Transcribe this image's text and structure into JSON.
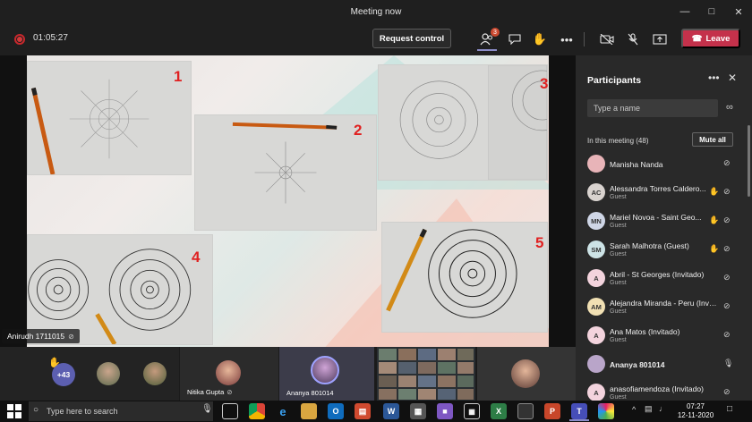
{
  "window": {
    "title": "Meeting now"
  },
  "toolbar": {
    "timer": "01:05:27",
    "request_control_label": "Request control",
    "participants_badge": "3",
    "leave_label": "Leave"
  },
  "share": {
    "photo_numbers": [
      "1",
      "2",
      "3",
      "4",
      "5"
    ],
    "speaker_name": "Anirudh 1711015"
  },
  "participants": {
    "title": "Participants",
    "search_placeholder": "Type a name",
    "in_meeting_label": "In this meeting (48)",
    "mute_all_label": "Mute all",
    "list": [
      {
        "initials": "",
        "name": "Manisha Nanda",
        "role": "",
        "hand": false,
        "avatar_color": "#e8b4b8"
      },
      {
        "initials": "AC",
        "name": "Alessandra Torres Caldero...",
        "role": "Guest",
        "hand": true,
        "avatar_color": "#d9d3cf"
      },
      {
        "initials": "MN",
        "name": "Mariel Novoa - Saint Geo...",
        "role": "Guest",
        "hand": true,
        "avatar_color": "#cfd6e6"
      },
      {
        "initials": "SM",
        "name": "Sarah Malhotra (Guest)",
        "role": "Guest",
        "hand": true,
        "avatar_color": "#cde3e6"
      },
      {
        "initials": "A",
        "name": "Abril - St Georges (Invitado)",
        "role": "Guest",
        "hand": false,
        "avatar_color": "#f3d3dd"
      },
      {
        "initials": "AM",
        "name": "Alejandra Miranda - Peru (Invit...",
        "role": "Guest",
        "hand": false,
        "avatar_color": "#f1e0b3"
      },
      {
        "initials": "A",
        "name": "Ana Matos (Invitado)",
        "role": "Guest",
        "hand": false,
        "avatar_color": "#f3d3dd"
      },
      {
        "initials": "",
        "name": "Ananya 801014",
        "role": "",
        "hand": false,
        "avatar_color": "#b9a5c9"
      },
      {
        "initials": "A",
        "name": "anasofiamendoza (Invitado)",
        "role": "Guest",
        "hand": false,
        "avatar_color": "#f3d3dd"
      }
    ]
  },
  "strip": {
    "overflow_count": "+43",
    "tile_names": [
      "Nitika Gupta",
      "Ananya 801014"
    ]
  },
  "taskbar": {
    "search_placeholder": "Type here to search",
    "time": "07:27",
    "date": "12-11-2020"
  }
}
